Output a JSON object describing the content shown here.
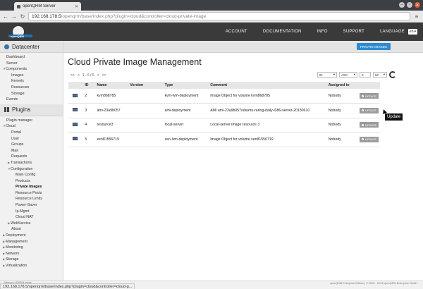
{
  "browser": {
    "tab_title": "openQRM Server",
    "address_host": "192.168.178.5",
    "address_path": "/openqrm/base/index.php?plugin=cloud&controller=cloud-private-image",
    "status_url": "192.168.178.5/openqrm/base/index.php?plugin=cloud&controller=cloud-p..."
  },
  "header": {
    "logo_text": "openQRM",
    "nav": [
      "ACCOUNT",
      "DOCUMENTATION",
      "INFO",
      "SUPPORT",
      "LANGUAGE"
    ],
    "language_value": "en"
  },
  "sidebar": {
    "datacenter_title": "Datacenter",
    "datacenter_items": [
      {
        "label": "Dashboard",
        "level": 0
      },
      {
        "label": "Server",
        "level": 0
      },
      {
        "label": "Components",
        "level": 0,
        "open": true
      },
      {
        "label": "Images",
        "level": 1
      },
      {
        "label": "Kernels",
        "level": 1
      },
      {
        "label": "Resources",
        "level": 1
      },
      {
        "label": "Storage",
        "level": 1
      },
      {
        "label": "Events",
        "level": 0
      }
    ],
    "plugins_title": "Plugins",
    "plugin_items": [
      {
        "label": "Plugin manager",
        "level": 0
      },
      {
        "label": "Cloud",
        "level": 0,
        "open": true
      },
      {
        "label": "Portal",
        "level": 1
      },
      {
        "label": "User",
        "level": 1
      },
      {
        "label": "Groups",
        "level": 1
      },
      {
        "label": "Mail",
        "level": 1
      },
      {
        "label": "Requests",
        "level": 1
      },
      {
        "label": "Transactions",
        "level": 1,
        "closed": true
      },
      {
        "label": "Configuration",
        "level": 1,
        "open": true
      },
      {
        "label": "Main Config",
        "level": 2
      },
      {
        "label": "Products",
        "level": 2
      },
      {
        "label": "Private Images",
        "level": 2,
        "active": true
      },
      {
        "label": "Resource Pools",
        "level": 2
      },
      {
        "label": "Resource Limits",
        "level": 2
      },
      {
        "label": "Power-Saver",
        "level": 2
      },
      {
        "label": "Ip-Mgmt",
        "level": 2
      },
      {
        "label": "Cloud NAT",
        "level": 2
      },
      {
        "label": "WebService",
        "level": 1,
        "closed": true
      },
      {
        "label": "About",
        "level": 1
      },
      {
        "label": "Deployment",
        "level": 0,
        "closed": true
      },
      {
        "label": "Management",
        "level": 0,
        "closed": true
      },
      {
        "label": "Monitoring",
        "level": 0,
        "closed": true
      },
      {
        "label": "Network",
        "level": 0,
        "closed": true
      },
      {
        "label": "Storage",
        "level": 0,
        "closed": true
      },
      {
        "label": "Virtualization",
        "level": 0,
        "closed": true
      }
    ]
  },
  "main": {
    "private_images_button": "PRIVATE IMAGES",
    "title": "Cloud Private Image Management",
    "pager": {
      "first": "<<",
      "prev": "<",
      "info": "1 - 6 / 6",
      "next": ">",
      "last": ">>"
    },
    "sort_field": "ID",
    "sort_order": "ASC",
    "offset": "0",
    "limit": "50",
    "table": {
      "columns": [
        "",
        "ID",
        "Name",
        "Version",
        "Type",
        "Comment",
        "Assigned to",
        ""
      ],
      "rows": [
        {
          "id": "2",
          "name": "kvm868785",
          "version": "",
          "type": "kvm-lvm-deployment",
          "comment": "Image Object for volume kvm868785",
          "assigned": "Nobody",
          "action": "UPDATE"
        },
        {
          "id": "3",
          "name": "ami-23a9b057",
          "version": "",
          "type": "ami-deployment",
          "comment": "AMI ami-23a9b057/ubuntu-raring-daily-i386-server-20130610",
          "assigned": "Nobody",
          "action": "UPDATE"
        },
        {
          "id": "4",
          "name": "resource3",
          "version": "",
          "type": "local-server",
          "comment": "Local-server image resource 3",
          "assigned": "Nobody",
          "action": "UPDATE"
        },
        {
          "id": "5",
          "name": "xen81556719",
          "version": "",
          "type": "xen-lvm-deployment",
          "comment": "Image Object for volume xen81556719",
          "assigned": "Nobody",
          "action": "UPDATE"
        }
      ]
    },
    "tooltip": "Update"
  },
  "footer": {
    "memory": "Memory: 820504 bytes",
    "copyright": "openQRM Enterprise Edition | © 2006 - 2013 openQRM Enterprise GmbH"
  }
}
